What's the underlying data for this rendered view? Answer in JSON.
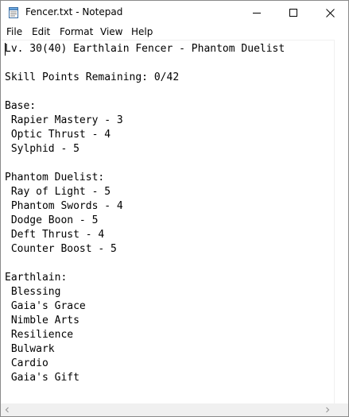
{
  "window": {
    "title": "Fencer.txt - Notepad"
  },
  "menu": {
    "items": [
      "File",
      "Edit",
      "Format",
      "View",
      "Help"
    ]
  },
  "document": {
    "lines": [
      "Lv. 30(40) Earthlain Fencer - Phantom Duelist",
      "",
      "Skill Points Remaining: 0/42",
      "",
      "Base:",
      " Rapier Mastery - 3",
      " Optic Thrust - 4",
      " Sylphid - 5",
      "",
      "Phantom Duelist:",
      " Ray of Light - 5",
      " Phantom Swords - 4",
      " Dodge Boon - 5",
      " Deft Thrust - 4",
      " Counter Boost - 5",
      "",
      "Earthlain:",
      " Blessing",
      " Gaia's Grace",
      " Nimble Arts",
      " Resilience",
      " Bulwark",
      " Cardio",
      " Gaia's Gift"
    ]
  },
  "icons": {
    "app": "notepad-icon",
    "minimize": "minimize-icon",
    "maximize": "maximize-icon",
    "close": "close-icon",
    "scroll_left": "chevron-left-icon",
    "scroll_right": "chevron-right-icon"
  }
}
